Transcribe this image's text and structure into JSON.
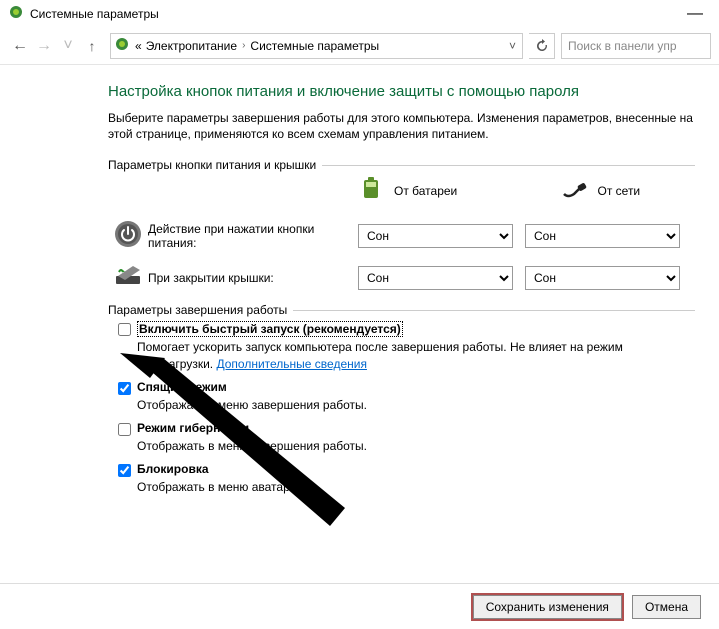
{
  "window": {
    "title": "Системные параметры"
  },
  "breadcrumb": {
    "drive": "«",
    "seg1": "Электропитание",
    "seg2": "Системные параметры"
  },
  "search": {
    "placeholder": "Поиск в панели упр"
  },
  "heading": "Настройка кнопок питания и включение защиты с помощью пароля",
  "intro": "Выберите параметры завершения работы для этого компьютера. Изменения параметров, внесенные на этой странице, применяются ко всем схемам управления питанием.",
  "section1": {
    "title": "Параметры кнопки питания и крышки",
    "col_battery": "От батареи",
    "col_ac": "От сети",
    "row_power_btn": "Действие при нажатии кнопки питания:",
    "row_lid": "При закрытии крышки:",
    "opt_sleep": "Сон"
  },
  "section2": {
    "title": "Параметры завершения работы",
    "fast_startup": {
      "label": "Включить быстрый запуск (рекомендуется)",
      "desc1": "Помогает ускорить запуск компьютера после завершения работы. Не влияет на режим перезагрузки. ",
      "link": "Дополнительные сведения"
    },
    "sleep": {
      "label": "Спящий режим",
      "desc": "Отображать в меню завершения работы."
    },
    "hibernate": {
      "label": "Режим гибернации",
      "desc": "Отображать в меню завершения работы."
    },
    "lock": {
      "label": "Блокировка",
      "desc": "Отображать в меню аватара."
    }
  },
  "footer": {
    "save": "Сохранить изменения",
    "cancel": "Отмена"
  }
}
